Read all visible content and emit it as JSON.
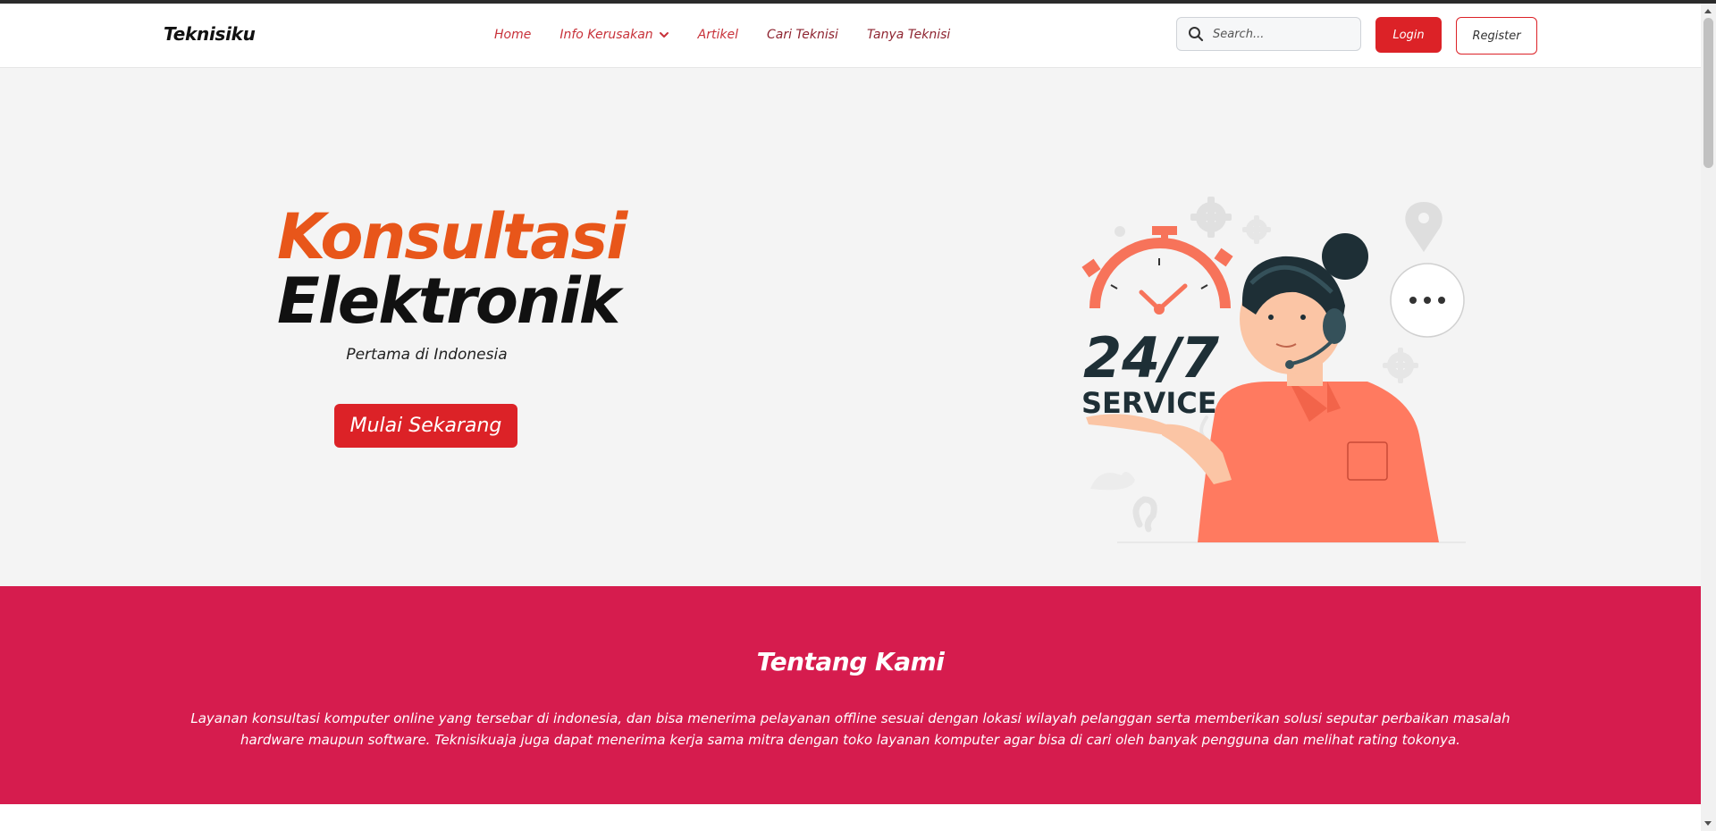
{
  "navbar": {
    "brand": "Teknisiku",
    "links": [
      {
        "label": "Home"
      },
      {
        "label": "Info Kerusakan"
      },
      {
        "label": "Artikel"
      },
      {
        "label": "Cari Teknisi"
      },
      {
        "label": "Tanya Teknisi"
      }
    ],
    "search_placeholder": "Search...",
    "login_label": "Login",
    "register_label": "Register"
  },
  "hero": {
    "title_line1": "Konsultasi",
    "title_line2": "Elektronik",
    "subtitle": "Pertama di Indonesia",
    "cta_label": "Mulai Sekarang",
    "illustration": {
      "big_text": "24/7",
      "service_text": "SERVICE"
    }
  },
  "about": {
    "title": "Tentang Kami",
    "text": "Layanan konsultasi komputer online yang tersebar di indonesia, dan bisa menerima pelayanan offline sesuai dengan lokasi wilayah pelanggan serta memberikan solusi seputar perbaikan masalah hardware maupun software. Teknisikuaja juga dapat menerima kerja sama mitra dengan toko layanan komputer agar bisa di cari oleh banyak pengguna dan melihat rating tokonya."
  },
  "colors": {
    "accent_red": "#dc2227",
    "hero_orange": "#e8561a",
    "about_bg": "#d61c4e",
    "illustration_coral": "#f7735a"
  },
  "icons": [
    "search-icon",
    "chevron-down-icon",
    "clock-icon",
    "gear-icon",
    "location-pin-icon",
    "chat-bubble-icon"
  ]
}
